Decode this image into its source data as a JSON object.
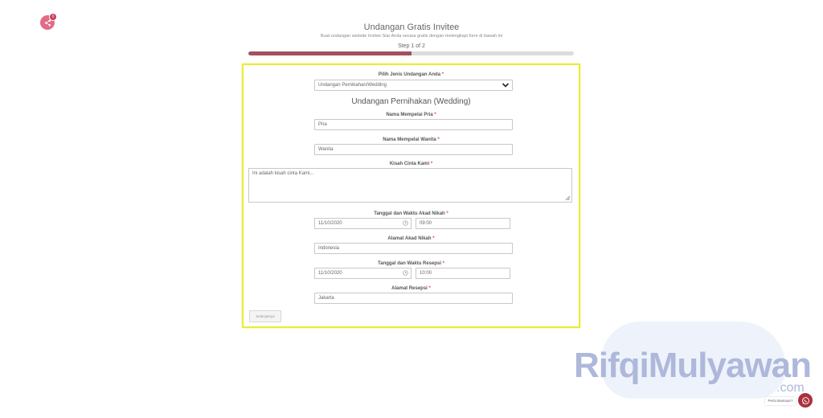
{
  "header": {
    "title": "Undangan Gratis Invitee",
    "subtitle": "Buat undangan website Invitee Siar Anda secara gratis dengan melengkapi form di bawah ini",
    "step_label": "Step 1 of 2",
    "progress_fraction": 0.5
  },
  "share": {
    "icon": "share-icon",
    "badge": "0"
  },
  "form": {
    "type_label": "Pilih Jenis Undangan Anda",
    "type_value": "Undangan Pernikahan/Wedding",
    "section_heading": "Undangan Pernihakan (Wedding)",
    "groom_label": "Nama Mempelai Pria",
    "groom_value": "Pria",
    "bride_label": "Nama Mempelai Wanita",
    "bride_value": "Wanita",
    "story_label": "Kisah Cinta Kami",
    "story_value": "Ini adalah kisah cinta Kami...",
    "akad_datetime_label": "Tanggal dan Waktu Akad Nikah",
    "akad_date": "11/10/2020",
    "akad_time": "09:00",
    "akad_address_label": "Alamat Akad Nikah",
    "akad_address": "Indonesia",
    "resepsi_datetime_label": "Tanggal dan Waktu Resepsi",
    "resepsi_date": "11/10/2020",
    "resepsi_time": "10:00",
    "resepsi_address_label": "Alamat Resepsi",
    "resepsi_address": "Jakarta",
    "required_mark": "*",
    "next_button": "Selanjutnya"
  },
  "watermark": {
    "name": "RifqiMulyawan",
    "suffix": ".com"
  },
  "help": {
    "text": "Perlu Bantuan?",
    "icon": "whatsapp-icon"
  },
  "colors": {
    "accent": "#a3505f",
    "highlight": "#e8ec3a",
    "share": "#e26b86"
  }
}
